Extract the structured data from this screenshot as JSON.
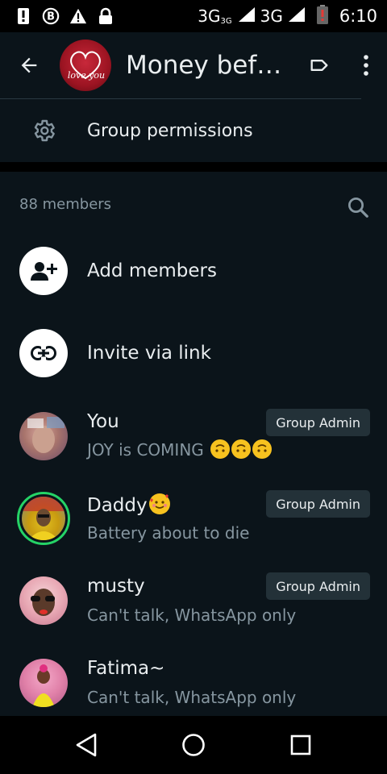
{
  "status_bar": {
    "time": "6:10",
    "network1": "3G",
    "network1_sup": "3G",
    "network2": "3G",
    "icons": [
      "notification-icon",
      "b-circle-icon",
      "warning-icon",
      "lock-icon",
      "signal-icon",
      "battery-low-icon"
    ]
  },
  "app_bar": {
    "group_title": "Money bef…",
    "avatar_text": "love you",
    "actions": [
      "label-icon",
      "more-vert-icon"
    ]
  },
  "permissions": {
    "label": "Group permissions",
    "icon": "gear-icon"
  },
  "members": {
    "count_label": "88 members",
    "add_label": "Add members",
    "invite_label": "Invite via link",
    "list": [
      {
        "name": "You",
        "status": "JOY is COMING",
        "badge": "Group Admin"
      },
      {
        "name": "Daddy",
        "status": "Battery about to die",
        "badge": "Group Admin"
      },
      {
        "name": "musty",
        "status": "Can't talk, WhatsApp only",
        "badge": "Group Admin"
      },
      {
        "name": "Fatima~",
        "status": "Can't talk, WhatsApp only",
        "badge": ""
      }
    ]
  },
  "colors": {
    "background": "#0b141a",
    "primary_text": "#e9edef",
    "secondary_text": "#8696a0",
    "badge_bg": "#233138",
    "status_ring": "#25d366"
  },
  "nav_bar": {
    "icons": [
      "back-triangle-icon",
      "home-circle-icon",
      "recents-square-icon"
    ]
  }
}
